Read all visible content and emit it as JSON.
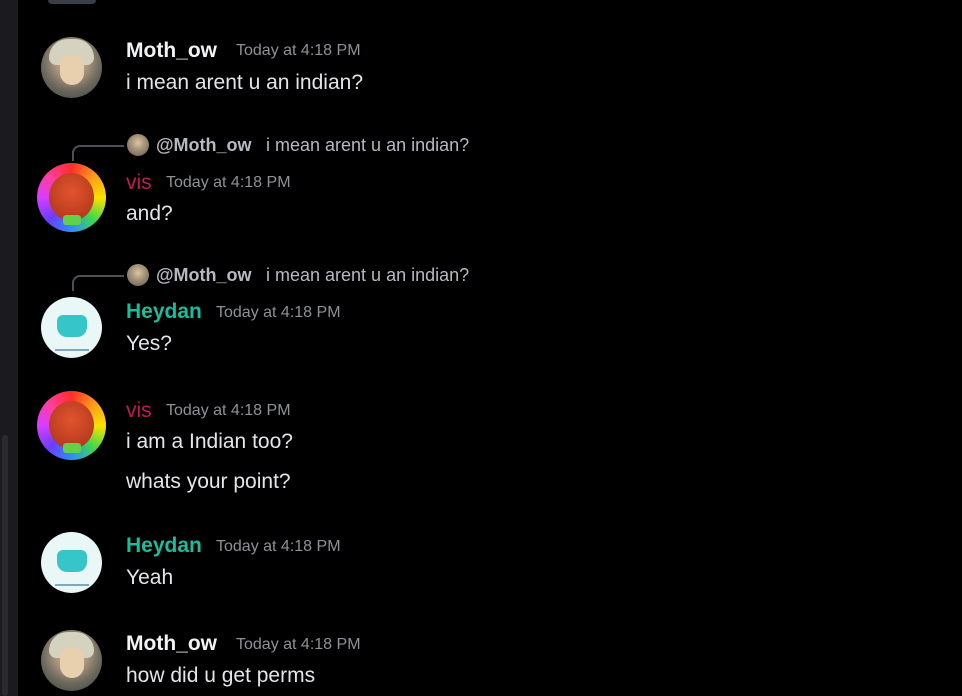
{
  "colors": {
    "moth_name": "#f2f3f5",
    "vis_name": "#c2185b",
    "heydan_name": "#1abc9c",
    "timestamp": "#8e9297",
    "message_text": "#e3e5e8",
    "background": "#000000"
  },
  "messages": [
    {
      "author": "Moth_ow",
      "timestamp": "Today at 4:18 PM",
      "lines": [
        "i mean arent u an indian?"
      ]
    },
    {
      "reply": {
        "user": "@Moth_ow",
        "text": "i mean arent u an indian?"
      },
      "author": "vis",
      "timestamp": "Today at 4:18 PM",
      "lines": [
        "and?"
      ]
    },
    {
      "reply": {
        "user": "@Moth_ow",
        "text": "i mean arent u an indian?"
      },
      "author": "Heydan",
      "timestamp": "Today at 4:18 PM",
      "lines": [
        "Yes?"
      ]
    },
    {
      "author": "vis",
      "timestamp": "Today at 4:18 PM",
      "lines": [
        "i am a Indian too?",
        "whats your point?"
      ]
    },
    {
      "author": "Heydan",
      "timestamp": "Today at 4:18 PM",
      "lines": [
        "Yeah"
      ]
    },
    {
      "author": "Moth_ow",
      "timestamp": "Today at 4:18 PM",
      "lines": [
        "how did u get perms"
      ]
    }
  ]
}
